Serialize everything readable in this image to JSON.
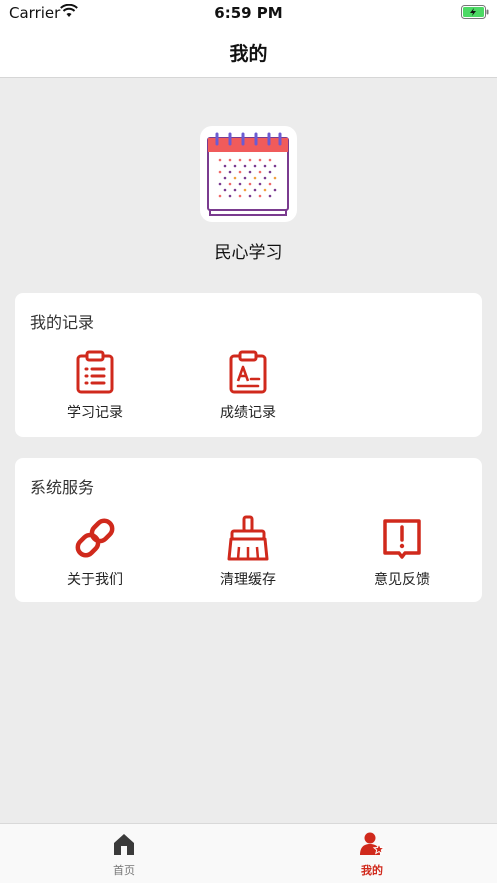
{
  "status_bar": {
    "carrier": "Carrier",
    "time": "6:59 PM"
  },
  "nav": {
    "title": "我的"
  },
  "app": {
    "name": "民心学习"
  },
  "records": {
    "title": "我的记录",
    "items": [
      {
        "label": "学习记录",
        "icon": "clipboard-list-icon"
      },
      {
        "label": "成绩记录",
        "icon": "clipboard-grade-icon"
      }
    ]
  },
  "services": {
    "title": "系统服务",
    "items": [
      {
        "label": "关于我们",
        "icon": "link-icon"
      },
      {
        "label": "清理缓存",
        "icon": "broom-icon"
      },
      {
        "label": "意见反馈",
        "icon": "feedback-icon"
      }
    ]
  },
  "tabbar": {
    "tabs": [
      {
        "label": "首页",
        "icon": "home-icon"
      },
      {
        "label": "我的",
        "icon": "user-icon",
        "active": true
      }
    ]
  },
  "colors": {
    "accent": "#d0291c",
    "inactive": "#777777",
    "background": "#ececec"
  }
}
